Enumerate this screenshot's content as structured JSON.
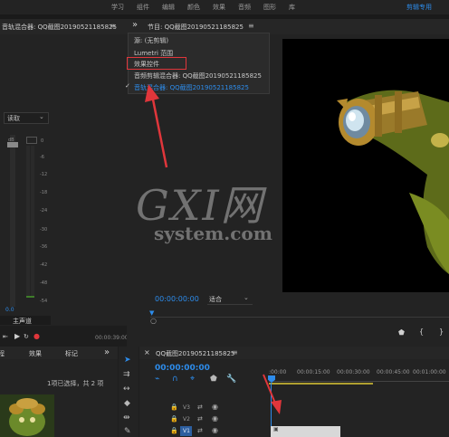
{
  "topbar": {
    "items": [
      "学习",
      "组件",
      "编辑",
      "颜色",
      "效果",
      "音频",
      "图形",
      "库"
    ],
    "active_label": "剪辑专用"
  },
  "left_panel": {
    "title": "音轨混合器: QQ截图20190521185825",
    "menu_glyph": "≡",
    "read_label": "读取",
    "db_values": [
      "dB",
      "0",
      "-6",
      "-12",
      "-18",
      "-24",
      "-30",
      "-36",
      "-42",
      "-48",
      "-54"
    ],
    "level_value": "0.0",
    "master_label": "主声道",
    "timecode": "00:00:39:00"
  },
  "program_panel": {
    "collapse_glyph": "»",
    "title": "节目: QQ截图20190521185825",
    "menu_glyph": "≡",
    "timecode": "00:00:00:00",
    "fit_label": "适合",
    "watermark_main": "GXI网",
    "watermark_sub": "system.com"
  },
  "dropdown_menu": {
    "items": [
      "源: (无剪辑)",
      "Lumetri 范围",
      "效果控件",
      "音频剪辑混合器: QQ截图20190521185825",
      "音轨混合器: QQ截图20190521185825"
    ],
    "checked_index": 4,
    "highlighted_index": 2
  },
  "bottom_left": {
    "tabs": [
      "程",
      "效果",
      "标记"
    ],
    "collapse_glyph": "»",
    "selection_text": "1项已选择，共 2 项"
  },
  "timeline": {
    "close_glyph": "×",
    "title": "QQ截图20190521185825",
    "menu_glyph": "≡",
    "timecode": "00:00:00:00",
    "ruler_ticks": [
      ":00:00",
      "00:00:15:00",
      "00:00:30:00",
      "00:00:45:00",
      "00:01:00:00"
    ],
    "tracks": [
      "V3",
      "V2",
      "V1"
    ]
  }
}
